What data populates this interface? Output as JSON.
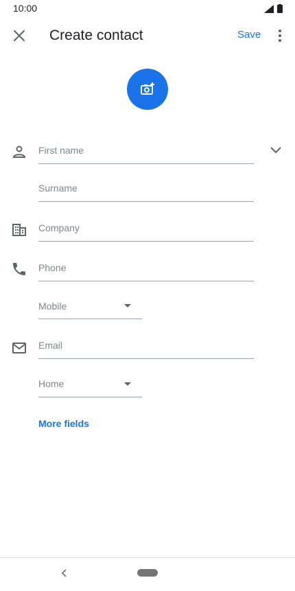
{
  "status_bar": {
    "time": "10:00"
  },
  "topbar": {
    "title": "Create contact",
    "save_label": "Save"
  },
  "form": {
    "first_name_placeholder": "First name",
    "surname_placeholder": "Surname",
    "company_placeholder": "Company",
    "phone_placeholder": "Phone",
    "phone_type": "Mobile",
    "email_placeholder": "Email",
    "email_type": "Home",
    "more_fields_label": "More fields"
  },
  "colors": {
    "accent": "#1a73e8",
    "hint": "#80868b"
  }
}
